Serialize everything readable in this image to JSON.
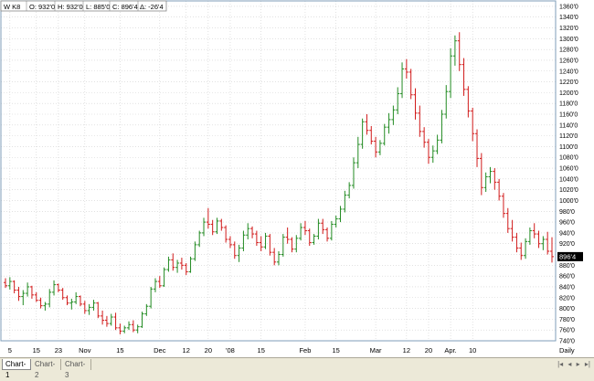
{
  "header": {
    "symbol": "W K8",
    "open": "O: 932'0",
    "high": "H: 932'0",
    "low": "L: 885'0",
    "close": "C: 896'4",
    "change": "Δ: -26'4"
  },
  "tabs": [
    {
      "label": "Chart-1",
      "active": true
    },
    {
      "label": "Chart-2",
      "active": false
    },
    {
      "label": "Chart-3",
      "active": false
    }
  ],
  "colors": {
    "up": "#228b22",
    "down": "#d11a1a",
    "axis": "#7f9db9",
    "grid": "#cfcfcf",
    "price_box": "#000000"
  },
  "chart_data": {
    "type": "ohlc-bar",
    "ylim": [
      740,
      1370
    ],
    "y_ticks": [
      "740'0",
      "760'0",
      "780'0",
      "800'0",
      "820'0",
      "840'0",
      "860'0",
      "880'0",
      "900'0",
      "920'0",
      "940'0",
      "960'0",
      "980'0",
      "1000'0",
      "1020'0",
      "1040'0",
      "1060'0",
      "1080'0",
      "1100'0",
      "1120'0",
      "1140'0",
      "1160'0",
      "1180'0",
      "1200'0",
      "1220'0",
      "1240'0",
      "1260'0",
      "1280'0",
      "1300'0",
      "1320'0",
      "1340'0",
      "1360'0"
    ],
    "last_price": "896'4",
    "periodicity": "Daily",
    "x_labels": [
      "5",
      "15",
      "23",
      "Nov",
      "15",
      "Dec",
      "12",
      "20",
      "'08",
      "15",
      "Feb",
      "15",
      "Mar",
      "12",
      "20",
      "Apr.",
      "10"
    ],
    "x_label_bar_index": [
      1,
      7,
      12,
      18,
      26,
      35,
      41,
      46,
      51,
      58,
      68,
      75,
      84,
      91,
      96,
      101,
      106
    ],
    "bars": [
      [
        848,
        856,
        838,
        842
      ],
      [
        842,
        858,
        835,
        850
      ],
      [
        850,
        852,
        828,
        834
      ],
      [
        834,
        840,
        814,
        822
      ],
      [
        822,
        834,
        806,
        828
      ],
      [
        828,
        848,
        822,
        840
      ],
      [
        840,
        842,
        818,
        825
      ],
      [
        825,
        830,
        812,
        815
      ],
      [
        815,
        820,
        800,
        805
      ],
      [
        805,
        812,
        796,
        808
      ],
      [
        808,
        836,
        802,
        830
      ],
      [
        830,
        852,
        824,
        844
      ],
      [
        844,
        846,
        830,
        834
      ],
      [
        834,
        838,
        816,
        820
      ],
      [
        820,
        824,
        806,
        810
      ],
      [
        810,
        818,
        798,
        812
      ],
      [
        812,
        830,
        808,
        822
      ],
      [
        822,
        824,
        804,
        808
      ],
      [
        808,
        814,
        790,
        796
      ],
      [
        796,
        808,
        788,
        802
      ],
      [
        802,
        816,
        796,
        810
      ],
      [
        810,
        812,
        782,
        786
      ],
      [
        786,
        796,
        770,
        778
      ],
      [
        778,
        786,
        766,
        772
      ],
      [
        772,
        790,
        768,
        784
      ],
      [
        784,
        792,
        760,
        764
      ],
      [
        764,
        772,
        752,
        758
      ],
      [
        758,
        768,
        754,
        764
      ],
      [
        764,
        776,
        760,
        770
      ],
      [
        770,
        778,
        756,
        760
      ],
      [
        760,
        770,
        754,
        766
      ],
      [
        766,
        794,
        764,
        790
      ],
      [
        790,
        808,
        786,
        804
      ],
      [
        804,
        840,
        800,
        836
      ],
      [
        836,
        856,
        830,
        850
      ],
      [
        850,
        860,
        838,
        842
      ],
      [
        842,
        876,
        840,
        872
      ],
      [
        872,
        896,
        868,
        890
      ],
      [
        890,
        902,
        870,
        876
      ],
      [
        876,
        890,
        866,
        884
      ],
      [
        884,
        894,
        872,
        880
      ],
      [
        880,
        884,
        862,
        868
      ],
      [
        868,
        896,
        866,
        892
      ],
      [
        892,
        924,
        888,
        918
      ],
      [
        918,
        944,
        914,
        940
      ],
      [
        940,
        968,
        934,
        960
      ],
      [
        960,
        986,
        948,
        956
      ],
      [
        956,
        964,
        936,
        942
      ],
      [
        942,
        968,
        938,
        962
      ],
      [
        962,
        966,
        944,
        950
      ],
      [
        950,
        954,
        922,
        928
      ],
      [
        928,
        934,
        912,
        918
      ],
      [
        918,
        924,
        892,
        898
      ],
      [
        898,
        918,
        886,
        912
      ],
      [
        912,
        944,
        906,
        936
      ],
      [
        936,
        958,
        928,
        948
      ],
      [
        948,
        952,
        930,
        938
      ],
      [
        938,
        944,
        916,
        922
      ],
      [
        922,
        934,
        906,
        914
      ],
      [
        914,
        940,
        910,
        934
      ],
      [
        934,
        938,
        898,
        904
      ],
      [
        904,
        912,
        880,
        886
      ],
      [
        886,
        906,
        880,
        900
      ],
      [
        900,
        938,
        896,
        932
      ],
      [
        932,
        950,
        920,
        928
      ],
      [
        928,
        932,
        904,
        910
      ],
      [
        910,
        936,
        904,
        930
      ],
      [
        930,
        958,
        926,
        950
      ],
      [
        950,
        962,
        936,
        944
      ],
      [
        944,
        948,
        916,
        922
      ],
      [
        922,
        938,
        918,
        934
      ],
      [
        934,
        966,
        928,
        958
      ],
      [
        958,
        966,
        938,
        946
      ],
      [
        946,
        950,
        924,
        930
      ],
      [
        930,
        962,
        926,
        956
      ],
      [
        956,
        972,
        950,
        966
      ],
      [
        966,
        990,
        960,
        984
      ],
      [
        984,
        1018,
        978,
        1010
      ],
      [
        1010,
        1034,
        1004,
        1028
      ],
      [
        1028,
        1080,
        1022,
        1070
      ],
      [
        1070,
        1118,
        1060,
        1104
      ],
      [
        1104,
        1152,
        1096,
        1146
      ],
      [
        1146,
        1160,
        1122,
        1130
      ],
      [
        1130,
        1138,
        1104,
        1110
      ],
      [
        1110,
        1118,
        1080,
        1090
      ],
      [
        1090,
        1112,
        1084,
        1106
      ],
      [
        1106,
        1142,
        1102,
        1136
      ],
      [
        1136,
        1162,
        1124,
        1150
      ],
      [
        1150,
        1176,
        1140,
        1168
      ],
      [
        1168,
        1210,
        1160,
        1198
      ],
      [
        1198,
        1256,
        1190,
        1244
      ],
      [
        1244,
        1262,
        1226,
        1238
      ],
      [
        1238,
        1244,
        1188,
        1196
      ],
      [
        1196,
        1208,
        1150,
        1162
      ],
      [
        1162,
        1176,
        1118,
        1128
      ],
      [
        1128,
        1136,
        1098,
        1108
      ],
      [
        1108,
        1114,
        1068,
        1080
      ],
      [
        1080,
        1102,
        1070,
        1092
      ],
      [
        1092,
        1122,
        1086,
        1112
      ],
      [
        1112,
        1168,
        1106,
        1160
      ],
      [
        1160,
        1214,
        1152,
        1202
      ],
      [
        1202,
        1282,
        1190,
        1268
      ],
      [
        1268,
        1306,
        1250,
        1296
      ],
      [
        1296,
        1312,
        1240,
        1252
      ],
      [
        1252,
        1264,
        1194,
        1206
      ],
      [
        1206,
        1212,
        1154,
        1166
      ],
      [
        1166,
        1172,
        1110,
        1124
      ],
      [
        1124,
        1132,
        1062,
        1078
      ],
      [
        1078,
        1088,
        1010,
        1024
      ],
      [
        1024,
        1052,
        1016,
        1044
      ],
      [
        1044,
        1062,
        1032,
        1054
      ],
      [
        1054,
        1060,
        1020,
        1034
      ],
      [
        1034,
        1040,
        1000,
        1008
      ],
      [
        1008,
        1014,
        968,
        976
      ],
      [
        976,
        986,
        940,
        948
      ],
      [
        948,
        964,
        924,
        932
      ],
      [
        932,
        940,
        904,
        912
      ],
      [
        912,
        922,
        890,
        898
      ],
      [
        898,
        930,
        892,
        924
      ],
      [
        924,
        950,
        918,
        944
      ],
      [
        944,
        958,
        930,
        938
      ],
      [
        938,
        944,
        912,
        920
      ],
      [
        920,
        934,
        908,
        928
      ],
      [
        928,
        942,
        900,
        906
      ],
      [
        906,
        932,
        885,
        896
      ]
    ]
  }
}
